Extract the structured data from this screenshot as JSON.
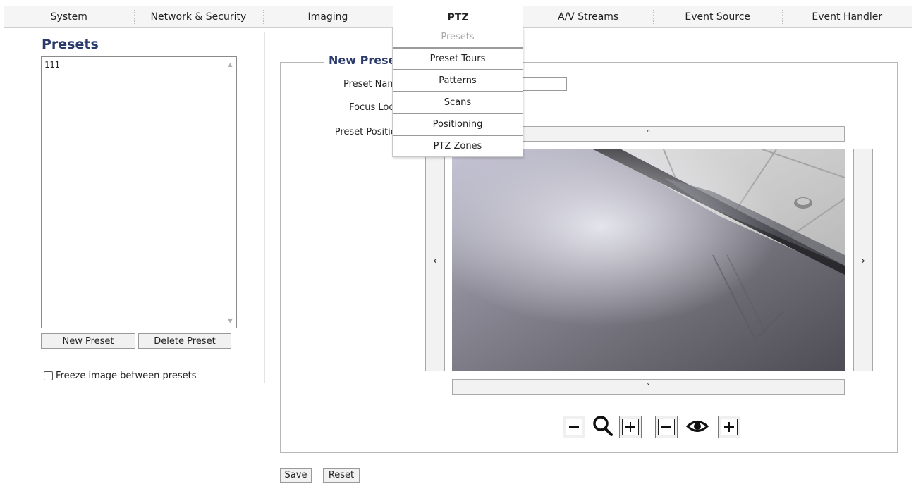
{
  "nav": {
    "tabs": [
      "System",
      "Network & Security",
      "Imaging",
      "PTZ",
      "A/V Streams",
      "Event Source",
      "Event Handler"
    ],
    "active": "PTZ"
  },
  "dropdown": {
    "items": [
      "Presets",
      "Preset Tours",
      "Patterns",
      "Scans",
      "Positioning",
      "PTZ Zones"
    ]
  },
  "left": {
    "title": "Presets",
    "list_items": [
      "111"
    ],
    "new_button": "New Preset",
    "delete_button": "Delete Preset",
    "freeze_label": "Freeze image between presets"
  },
  "form": {
    "legend": "New Preset",
    "preset_name_label": "Preset Name",
    "focus_lock_label": "Focus Lock",
    "preset_position_label": "Preset Position",
    "pan_up": "˄",
    "pan_down": "˅",
    "pan_left": "‹",
    "pan_right": "›"
  },
  "footer": {
    "save": "Save",
    "reset": "Reset"
  },
  "icons": {
    "zoom": "magnifier-icon",
    "focus": "eye-icon"
  }
}
